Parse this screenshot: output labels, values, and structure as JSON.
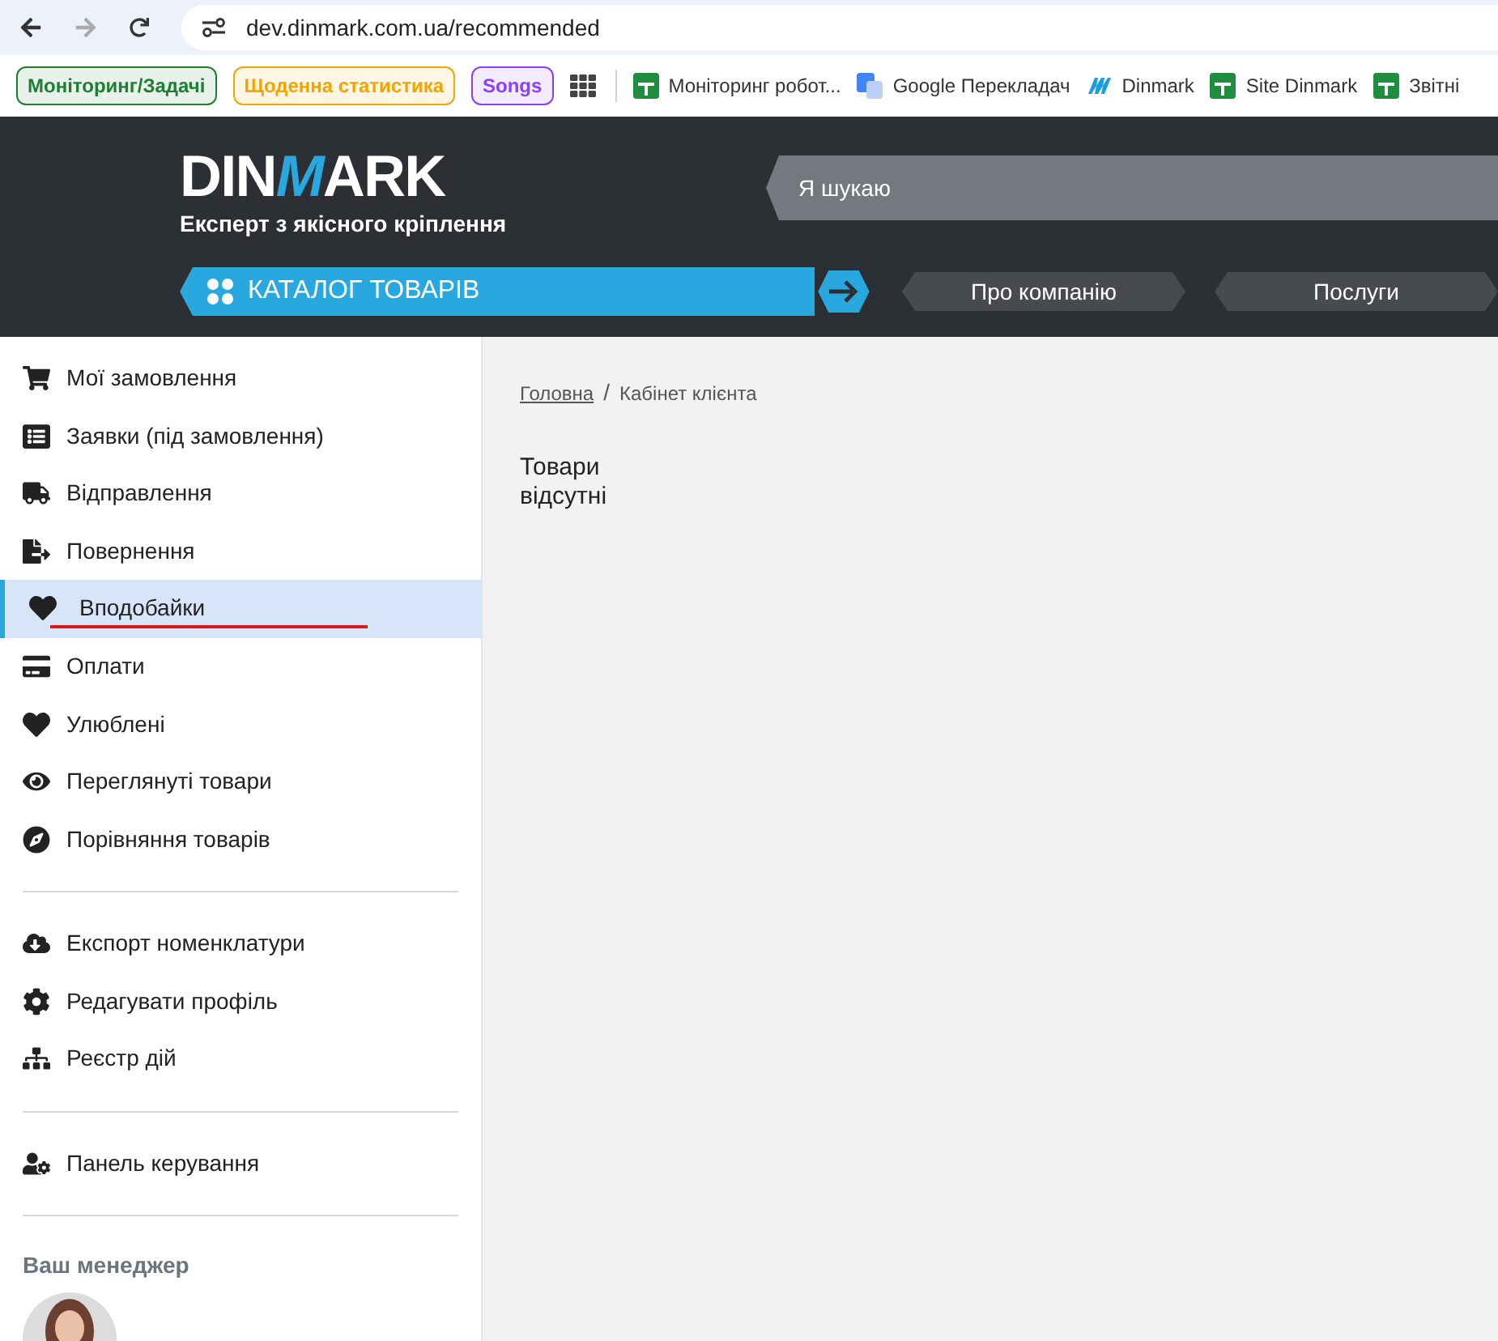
{
  "browser": {
    "url": "dev.dinmark.com.ua/recommended"
  },
  "bookmarks": [
    {
      "kind": "chip",
      "label": "Моніторинг/Задачі",
      "color": "#1e7e34"
    },
    {
      "kind": "chip",
      "label": "Щоденна статистика",
      "color": "#f0a500"
    },
    {
      "kind": "chip",
      "label": "Songs",
      "color": "#8a3ffc"
    },
    {
      "kind": "apps"
    },
    {
      "kind": "link",
      "label": "Моніторинг робот..."
    },
    {
      "kind": "link",
      "label": "Google Перекладач"
    },
    {
      "kind": "link",
      "label": "Dinmark"
    },
    {
      "kind": "link",
      "label": "Site Dinmark"
    },
    {
      "kind": "link",
      "label": "Звітні"
    }
  ],
  "header": {
    "logo_left": "DIN",
    "logo_mid": "M",
    "logo_right": "ARK",
    "tagline": "Експерт з якісного кріплення",
    "search": {
      "placeholder": "Я шукаю"
    },
    "catalog": "КАТАЛОГ ТОВАРІВ",
    "nav": [
      "Про компанію",
      "Послуги"
    ]
  },
  "sidebar": {
    "groups": [
      {
        "items": [
          {
            "label": "Мої замовлення",
            "selected": false
          },
          {
            "label": "Заявки (під замовлення)",
            "selected": false
          },
          {
            "label": "Відправлення",
            "selected": false
          },
          {
            "label": "Повернення",
            "selected": false
          },
          {
            "label": "Вподобайки",
            "selected": true
          },
          {
            "label": "Оплати",
            "selected": false
          },
          {
            "label": "Улюблені",
            "selected": false
          },
          {
            "label": "Переглянуті товари",
            "selected": false
          },
          {
            "label": "Порівняння товарів",
            "selected": false
          }
        ]
      },
      {
        "items": [
          {
            "label": "Експорт номенклатури",
            "selected": false
          },
          {
            "label": "Редагувати профіль",
            "selected": false
          },
          {
            "label": "Реєстр дій",
            "selected": false
          }
        ]
      },
      {
        "items": [
          {
            "label": "Панель керування",
            "selected": false
          }
        ]
      }
    ],
    "manager_heading": "Ваш менеджер"
  },
  "breadcrumbs": [
    {
      "label": "Головна",
      "kind": "link"
    },
    {
      "label": "Кабінет клієнта",
      "kind": "current"
    }
  ],
  "breadcrumb_separator": "/",
  "empty_message": "Товари відсутні"
}
